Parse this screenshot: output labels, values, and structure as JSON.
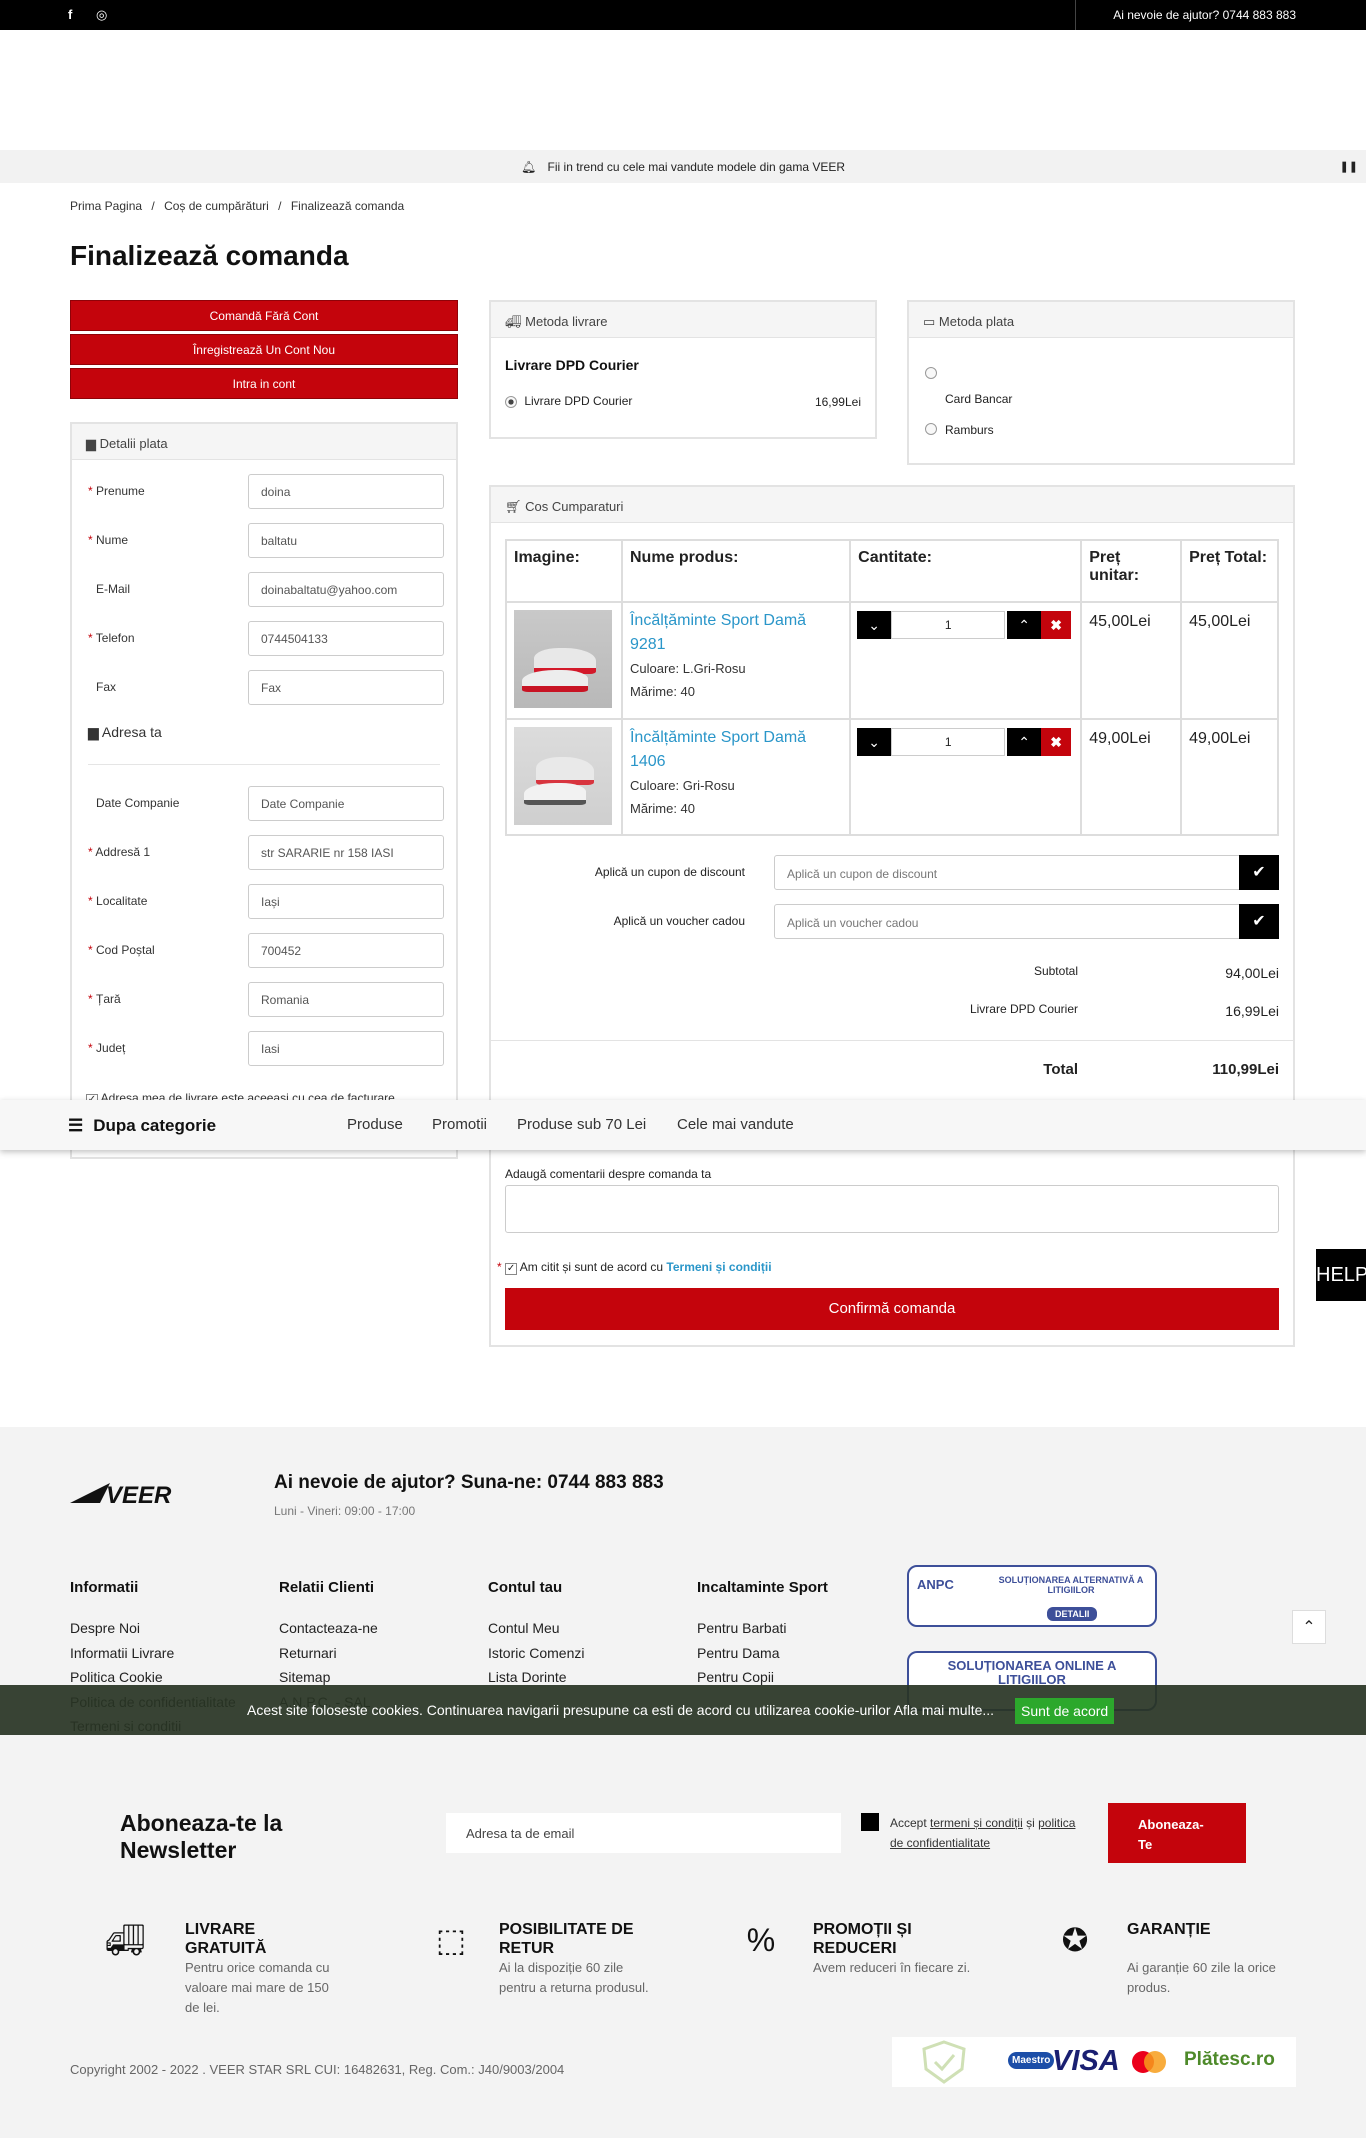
{
  "topbar": {
    "help": "Ai nevoie de ajutor? 0744 883 883",
    "facebook_icon": "f",
    "instagram_icon": "◎"
  },
  "promo": {
    "text": "Fii in trend cu cele mai vandute modele din gama VEER",
    "pause": "❚❚"
  },
  "breadcrumb": {
    "home": "Prima Pagina",
    "cart": "Coș de cumpărături",
    "current": "Finalizează comanda",
    "sep": "/"
  },
  "page_title": "Finalizează comanda",
  "account_buttons": {
    "guest": "Comandă Fără Cont",
    "register": "Înregistrează Un Cont Nou",
    "login": "Intra in cont"
  },
  "payment_details": {
    "header": "Detalii plata",
    "fields": [
      {
        "label": "Prenume",
        "value": "doina",
        "required": true
      },
      {
        "label": "Nume",
        "value": "baltatu",
        "required": true
      },
      {
        "label": "E-Mail",
        "value": "doinabaltatu@yahoo.com",
        "required": false
      },
      {
        "label": "Telefon",
        "value": "0744504133",
        "required": true
      },
      {
        "label": "Fax",
        "value": "Fax",
        "required": false
      }
    ],
    "address_header": "Adresa ta",
    "address_fields": [
      {
        "label": "Date Companie",
        "value": "Date Companie",
        "required": false
      },
      {
        "label": "Addresă 1",
        "value": "str SARARIE  nr 158  IASI",
        "required": true
      },
      {
        "label": "Localitate",
        "value": "Iași",
        "required": true
      },
      {
        "label": "Cod Poștal",
        "value": "700452",
        "required": true
      },
      {
        "label": "Țară",
        "value": "Romania",
        "required": true
      },
      {
        "label": "Județ",
        "value": "Iasi",
        "required": true
      }
    ],
    "same_address": "Adresa mea de livrare este aceeasi cu cea de facturare."
  },
  "shipping": {
    "header": "Metoda livrare",
    "title": "Livrare DPD Courier",
    "option": "Livrare DPD Courier",
    "price": "16,99Lei"
  },
  "payment": {
    "header": "Metoda plata",
    "options": [
      "Card Bancar",
      "Ramburs"
    ]
  },
  "cart": {
    "header": "Cos Cumparaturi",
    "columns": {
      "image": "Imagine:",
      "name": "Nume produs:",
      "qty": "Cantitate:",
      "unit": "Preț unitar:",
      "total": "Preț Total:"
    },
    "items": [
      {
        "name": "Încălțăminte Sport Damă 9281",
        "color": "Culoare: L.Gri-Rosu",
        "size": "Mărime: 40",
        "qty": "1",
        "unit": "45,00Lei",
        "total": "45,00Lei"
      },
      {
        "name": "Încălțăminte Sport Damă 1406",
        "color": "Culoare: Gri-Rosu",
        "size": "Mărime: 40",
        "qty": "1",
        "unit": "49,00Lei",
        "total": "49,00Lei"
      }
    ],
    "coupon_label": "Aplică un cupon de discount",
    "coupon_placeholder": "Aplică un cupon de discount",
    "voucher_label": "Aplică un voucher cadou",
    "voucher_placeholder": "Aplică un voucher cadou",
    "subtotal_label": "Subtotal",
    "subtotal": "94,00Lei",
    "shipping_label": "Livrare DPD Courier",
    "shipping": "16,99Lei",
    "total_label": "Total",
    "total": "110,99Lei"
  },
  "comments_label": "Adaugă comentarii despre comanda ta",
  "terms": {
    "text": "Am citit și sunt de acord cu",
    "link": "Termeni și condiții"
  },
  "confirm": "Confirmă comanda",
  "help_tab": "HELP",
  "catbar": {
    "title": "Dupa categorie",
    "items": [
      "Produse",
      "Promotii",
      "Produse sub 70 Lei",
      "Cele mai vandute"
    ]
  },
  "footer": {
    "logo": "VEER",
    "help_title": "Ai nevoie de ajutor? Suna-ne: 0744 883 883",
    "hours": "Luni - Vineri: 09:00 - 17:00",
    "columns": [
      {
        "title": "Informatii",
        "links": [
          "Despre Noi",
          "Informatii Livrare",
          "Politica Cookie",
          "Politica de confidentialitate",
          "Termeni si conditii"
        ]
      },
      {
        "title": "Relatii Clienti",
        "links": [
          "Contacteaza-ne",
          "Returnari",
          "Sitemap",
          "A.N.P.C. - SAL"
        ]
      },
      {
        "title": "Contul tau",
        "links": [
          "Contul Meu",
          "Istoric Comenzi",
          "Lista Dorinte"
        ]
      },
      {
        "title": "Incaltaminte Sport",
        "links": [
          "Pentru Barbati",
          "Pentru Dama",
          "Pentru Copii"
        ]
      }
    ],
    "anpc1": {
      "brand": "ANPC",
      "title": "SOLUȚIONAREA ALTERNATIVĂ A LITIGIILOR",
      "details": "DETALII"
    },
    "anpc2": {
      "title": "SOLUȚIONAREA ONLINE A LITIGIILOR"
    },
    "newsletter": {
      "title": "Aboneaza-te la Newsletter",
      "placeholder": "Adresa ta de email",
      "accept_pre": "Accept",
      "terms": "termeni și condiții",
      "and": "și",
      "privacy": "politica de confidentialitate",
      "button": "Aboneaza-Te"
    },
    "features": [
      {
        "title": "LIVRARE GRATUITĂ",
        "desc": "Pentru orice comanda cu valoare mai mare de 150 de lei."
      },
      {
        "title": "POSIBILITATE DE RETUR",
        "desc": "Ai la dispoziție 60 zile pentru a returna produsul."
      },
      {
        "title": "PROMOȚII ȘI REDUCERI",
        "desc": "Avem reduceri în fiecare zi."
      },
      {
        "title": "GARANȚIE",
        "desc": "Ai garanție 60 zile la orice produs."
      }
    ],
    "copyright": "Copyright 2002 - 2022 . VEER STAR SRL CUI: 16482631, Reg. Com.: J40/9003/2004",
    "payments": {
      "maestro": "Maestro",
      "visa": "VISA",
      "platesc": "Plătesc.ro"
    }
  },
  "cookie": {
    "text": "Acest site foloseste cookies. Continuarea navigarii presupune ca esti de acord cu utilizarea cookie-urilor",
    "more": "Afla mai multe...",
    "accept": "Sunt de acord"
  }
}
